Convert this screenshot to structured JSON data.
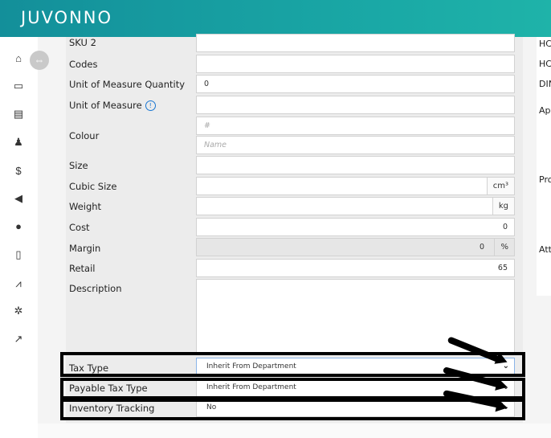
{
  "app": {
    "logo": "JUVONNO"
  },
  "nav": [
    {
      "name": "home-icon",
      "glyph": "⌂"
    },
    {
      "name": "monitor-icon",
      "glyph": "▭"
    },
    {
      "name": "clipboard-icon",
      "glyph": "▤"
    },
    {
      "name": "users-icon",
      "glyph": "♟"
    },
    {
      "name": "dollar-icon",
      "glyph": "$"
    },
    {
      "name": "megaphone-icon",
      "glyph": "◀"
    },
    {
      "name": "chat-icon",
      "glyph": "●"
    },
    {
      "name": "document-icon",
      "glyph": "▯"
    },
    {
      "name": "chart-icon",
      "glyph": "⩘"
    },
    {
      "name": "gear-icon",
      "glyph": "✲"
    },
    {
      "name": "external-link-icon",
      "glyph": "↗"
    }
  ],
  "form": {
    "sku2_label": "SKU 2",
    "codes_label": "Codes",
    "uom_qty_label": "Unit of Measure Quantity",
    "uom_qty_value": "0",
    "uom_label": "Unit of Measure",
    "colour_label": "Colour",
    "colour_hex_placeholder": "#",
    "colour_name_placeholder": "Name",
    "size_label": "Size",
    "cubic_label": "Cubic Size",
    "cubic_unit": "cm³",
    "weight_label": "Weight",
    "weight_unit": "kg",
    "cost_label": "Cost",
    "cost_value": "0",
    "margin_label": "Margin",
    "margin_value": "0",
    "margin_unit": "%",
    "retail_label": "Retail",
    "retail_value": "65",
    "description_label": "Description",
    "tax_type_label": "Tax Type",
    "tax_type_value": "Inherit From Department",
    "payable_tax_label": "Payable Tax Type",
    "payable_tax_value": "Inherit From Department",
    "inventory_label": "Inventory Tracking",
    "inventory_value": "No"
  },
  "right_panel": [
    "HC",
    "HC",
    "DIN",
    "Ap",
    "Pro",
    "Att"
  ]
}
